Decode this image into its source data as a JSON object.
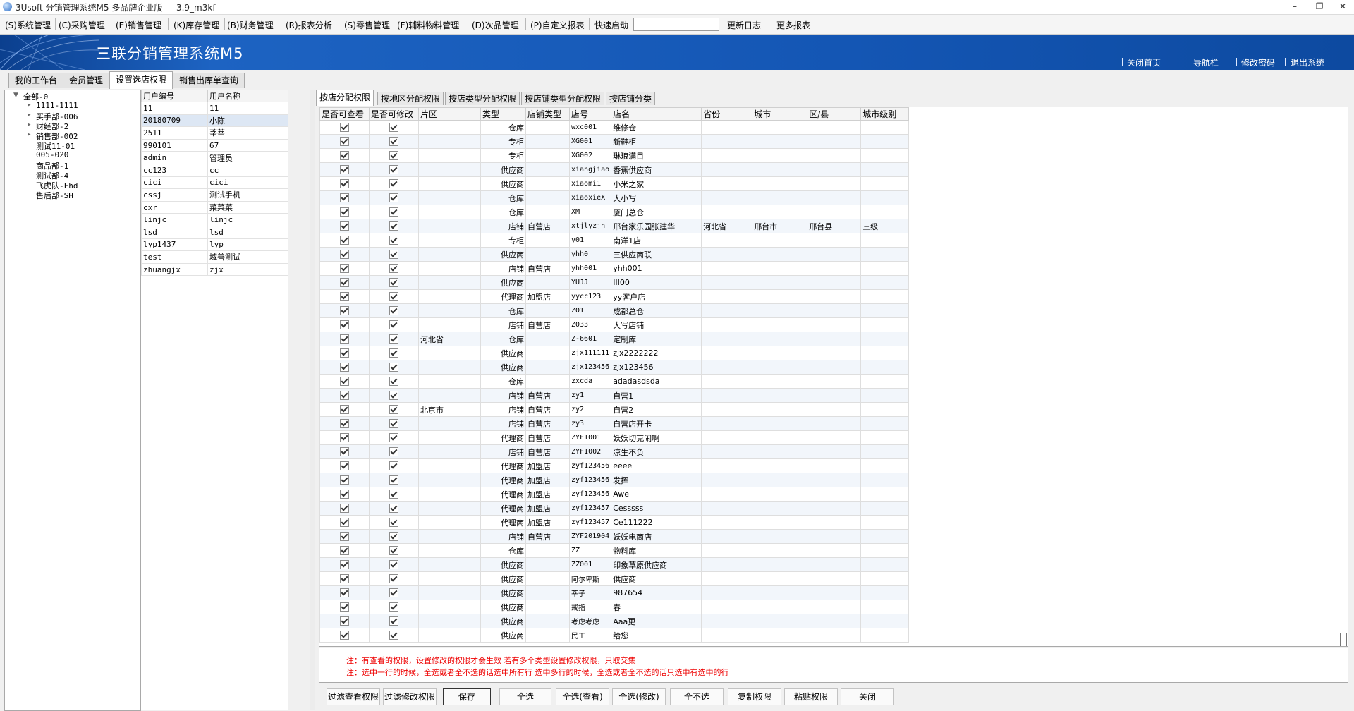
{
  "window": {
    "title": "3Usoft 分销管理系统M5 多品牌企业版 — 3.9_m3kf"
  },
  "menu": {
    "items": [
      "(S)系统管理",
      "(C)采购管理",
      "(E)销售管理",
      "(K)库存管理",
      "(B)财务管理",
      "(R)报表分析",
      "(S)零售管理",
      "(F)辅料物料管理",
      "(D)次品管理",
      "(P)自定义报表"
    ],
    "quick_launch_label": "快速启动",
    "quick_launch_value": "",
    "changelog": "更新日志",
    "more_reports": "更多报表"
  },
  "banner": {
    "title": "三联分销管理系统M5",
    "links": [
      "关闭首页",
      "导航栏",
      "修改密码",
      "退出系统"
    ]
  },
  "main_tabs": [
    "我的工作台",
    "会员管理",
    "设置选店权限",
    "销售出库单查询"
  ],
  "tree": {
    "root": "全部-0",
    "nodes": [
      {
        "label": "1111-1111",
        "expandable": true
      },
      {
        "label": "买手部-006",
        "expandable": true
      },
      {
        "label": "财经部-2",
        "expandable": true
      },
      {
        "label": "销售部-002",
        "expandable": true
      },
      {
        "label": "测试11-01",
        "expandable": false
      },
      {
        "label": "005-020",
        "expandable": false
      },
      {
        "label": "商品部-1",
        "expandable": false
      },
      {
        "label": "测试部-4",
        "expandable": false
      },
      {
        "label": "飞虎队-Fhd",
        "expandable": false
      },
      {
        "label": "售后部-SH",
        "expandable": false
      }
    ]
  },
  "users": {
    "headers": [
      "用户编号",
      "用户名称"
    ],
    "rows": [
      [
        "11",
        "11"
      ],
      [
        "20180709",
        "小陈"
      ],
      [
        "2511",
        "莘莘"
      ],
      [
        "990101",
        "67"
      ],
      [
        "admin",
        "管理员"
      ],
      [
        "cc123",
        "cc"
      ],
      [
        "cici",
        "cici"
      ],
      [
        "cssj",
        "测试手机"
      ],
      [
        "cxr",
        "菜菜菜"
      ],
      [
        "linjc",
        "linjc"
      ],
      [
        "lsd",
        "lsd"
      ],
      [
        "lyp1437",
        "lyp"
      ],
      [
        "test",
        "域善测试"
      ],
      [
        "zhuangjx",
        "zjx"
      ]
    ],
    "selected_index": 1
  },
  "sub_tabs": [
    "按店分配权限",
    "按地区分配权限",
    "按店类型分配权限",
    "按店铺类型分配权限",
    "按店铺分类"
  ],
  "grid": {
    "headers": [
      "是否可查看",
      "是否可修改",
      "片区",
      "类型",
      "店铺类型",
      "店号",
      "店名",
      "省份",
      "城市",
      "区/县",
      "城市级别"
    ],
    "rows": [
      [
        "",
        "仓库",
        "",
        "wxc001",
        "维修仓",
        "",
        "",
        "",
        ""
      ],
      [
        "",
        "专柜",
        "",
        "XG001",
        "新鞋柜",
        "",
        "",
        "",
        ""
      ],
      [
        "",
        "专柜",
        "",
        "XG002",
        "琳琅满目",
        "",
        "",
        "",
        ""
      ],
      [
        "",
        "供应商",
        "",
        "xiangjiao",
        "香蕉供应商",
        "",
        "",
        "",
        ""
      ],
      [
        "",
        "供应商",
        "",
        "xiaomi1",
        "小米之家",
        "",
        "",
        "",
        ""
      ],
      [
        "",
        "仓库",
        "",
        "xiaoxieX",
        "大小写",
        "",
        "",
        "",
        ""
      ],
      [
        "",
        "仓库",
        "",
        "XM",
        "厦门总仓",
        "",
        "",
        "",
        ""
      ],
      [
        "",
        "店铺",
        "自营店",
        "xtjlyzjh",
        "邢台家乐园张建华",
        "河北省",
        "邢台市",
        "邢台县",
        "三级"
      ],
      [
        "",
        "专柜",
        "",
        "y01",
        "南洋1店",
        "",
        "",
        "",
        ""
      ],
      [
        "",
        "供应商",
        "",
        "yhh0",
        "三供应商联",
        "",
        "",
        "",
        ""
      ],
      [
        "",
        "店铺",
        "自营店",
        "yhh001",
        "yhh001",
        "",
        "",
        "",
        ""
      ],
      [
        "",
        "供应商",
        "",
        "YUJJ",
        "III00",
        "",
        "",
        "",
        ""
      ],
      [
        "",
        "代理商",
        "加盟店",
        "yycc123",
        "yy客户店",
        "",
        "",
        "",
        ""
      ],
      [
        "",
        "仓库",
        "",
        "Z01",
        "成都总仓",
        "",
        "",
        "",
        ""
      ],
      [
        "",
        "店铺",
        "自营店",
        "Z033",
        "大写店铺",
        "",
        "",
        "",
        ""
      ],
      [
        "河北省",
        "仓库",
        "",
        "Z-6601",
        "定制库",
        "",
        "",
        "",
        ""
      ],
      [
        "",
        "供应商",
        "",
        "zjx111111",
        "zjx2222222",
        "",
        "",
        "",
        ""
      ],
      [
        "",
        "供应商",
        "",
        "zjx123456",
        "zjx123456",
        "",
        "",
        "",
        ""
      ],
      [
        "",
        "仓库",
        "",
        "zxcda",
        "adadasdsda",
        "",
        "",
        "",
        ""
      ],
      [
        "",
        "店铺",
        "自营店",
        "zy1",
        "自营1",
        "",
        "",
        "",
        ""
      ],
      [
        "北京市",
        "店铺",
        "自营店",
        "zy2",
        "自营2",
        "",
        "",
        "",
        ""
      ],
      [
        "",
        "店铺",
        "自营店",
        "zy3",
        "自营店开卡",
        "",
        "",
        "",
        ""
      ],
      [
        "",
        "代理商",
        "自营店",
        "ZYF1001",
        "妖妖切克闹啊",
        "",
        "",
        "",
        ""
      ],
      [
        "",
        "店铺",
        "自营店",
        "ZYF1002",
        "凉生不负",
        "",
        "",
        "",
        ""
      ],
      [
        "",
        "代理商",
        "加盟店",
        "zyf123456",
        "eeee",
        "",
        "",
        "",
        ""
      ],
      [
        "",
        "代理商",
        "加盟店",
        "zyf123456",
        "发挥",
        "",
        "",
        "",
        ""
      ],
      [
        "",
        "代理商",
        "加盟店",
        "zyf123456",
        "Awe",
        "",
        "",
        "",
        ""
      ],
      [
        "",
        "代理商",
        "加盟店",
        "zyf123457",
        "Cesssss",
        "",
        "",
        "",
        ""
      ],
      [
        "",
        "代理商",
        "加盟店",
        "zyf123457",
        "Ce111222",
        "",
        "",
        "",
        ""
      ],
      [
        "",
        "店铺",
        "自营店",
        "ZYF201904",
        "妖妖电商店",
        "",
        "",
        "",
        ""
      ],
      [
        "",
        "仓库",
        "",
        "ZZ",
        "物料库",
        "",
        "",
        "",
        ""
      ],
      [
        "",
        "供应商",
        "",
        "ZZ001",
        "印象草原供应商",
        "",
        "",
        "",
        ""
      ],
      [
        "",
        "供应商",
        "",
        "阿尔卑斯",
        "供应商",
        "",
        "",
        "",
        ""
      ],
      [
        "",
        "供应商",
        "",
        "莘子",
        "987654",
        "",
        "",
        "",
        ""
      ],
      [
        "",
        "供应商",
        "",
        "戒指",
        "春",
        "",
        "",
        "",
        ""
      ],
      [
        "",
        "供应商",
        "",
        "考虑考虑",
        "Aaa更",
        "",
        "",
        "",
        ""
      ],
      [
        "",
        "供应商",
        "",
        "民工",
        "给您",
        "",
        "",
        "",
        ""
      ]
    ]
  },
  "notes": {
    "line1": "注：有查看的权限，设置修改的权限才会生效      若有多个类型设置修改权限，只取交集",
    "line2": "注：选中一行的时候，全选或者全不选的话选中所有行    选中多行的时候，全选或者全不选的话只选中有选中的行"
  },
  "buttons": [
    "过滤查看权限",
    "过滤修改权限",
    "保存",
    "全选",
    "全选(查看)",
    "全选(修改)",
    "全不选",
    "复制权限",
    "粘贴权限",
    "关闭"
  ],
  "colors": {
    "banner": "#1456b4",
    "note_red": "#ee0000",
    "row_alt": "#f2f6fb",
    "selected_row": "#dde7f4"
  }
}
